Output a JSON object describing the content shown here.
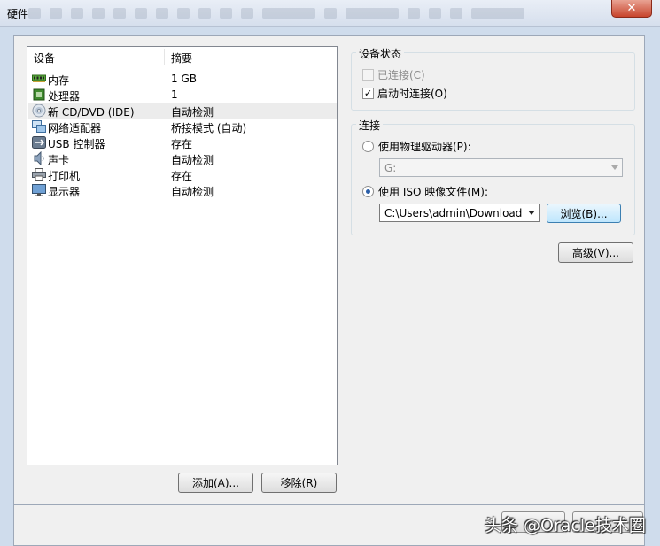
{
  "window": {
    "title": "硬件",
    "close_glyph": "✕"
  },
  "device_list": {
    "col_device": "设备",
    "col_summary": "摘要",
    "rows": [
      {
        "name": "内存",
        "summary": "1 GB",
        "icon": "memory-icon"
      },
      {
        "name": "处理器",
        "summary": "1",
        "icon": "processor-icon"
      },
      {
        "name": "新 CD/DVD (IDE)",
        "summary": "自动检测",
        "icon": "cd-dvd-icon",
        "selected": true
      },
      {
        "name": "网络适配器",
        "summary": "桥接模式 (自动)",
        "icon": "network-adapter-icon"
      },
      {
        "name": "USB 控制器",
        "summary": "存在",
        "icon": "usb-icon"
      },
      {
        "name": "声卡",
        "summary": "自动检测",
        "icon": "sound-card-icon"
      },
      {
        "name": "打印机",
        "summary": "存在",
        "icon": "printer-icon"
      },
      {
        "name": "显示器",
        "summary": "自动检测",
        "icon": "monitor-icon"
      }
    ]
  },
  "list_buttons": {
    "add": "添加(A)...",
    "remove": "移除(R)"
  },
  "device_status": {
    "title": "设备状态",
    "connected": {
      "label": "已连接(C)",
      "checked": false,
      "enabled": false
    },
    "connect_at_power_on": {
      "label": "启动时连接(O)",
      "checked": true,
      "enabled": true
    }
  },
  "connection": {
    "title": "连接",
    "physical_drive": {
      "label": "使用物理驱动器(P):",
      "selected": false
    },
    "physical_drive_value": "G:",
    "iso_image": {
      "label": "使用 ISO 映像文件(M):",
      "selected": true
    },
    "iso_path": "C:\\Users\\admin\\Downloads\\",
    "browse_button": "浏览(B)..."
  },
  "advanced_button": "高级(V)...",
  "watermark": "头条 @Oracle技术圈",
  "colors": {
    "frame": "#cfdcec",
    "panel": "#f0f0f0",
    "close": "#c7442c",
    "focus_border": "#3c7fb1"
  }
}
